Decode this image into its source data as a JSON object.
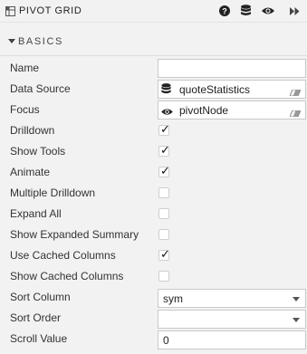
{
  "header": {
    "title": "PIVOT GRID",
    "icons": [
      "pivot-grid-icon",
      "help-icon",
      "database-icon",
      "eye-icon",
      "double-chevron-right-icon"
    ]
  },
  "section": {
    "title": "BASICS",
    "toggle_icon": "caret-down-icon"
  },
  "fields": {
    "name": {
      "label": "Name",
      "value": ""
    },
    "data_source": {
      "label": "Data Source",
      "value": "quoteStatistics",
      "icon": "database-icon"
    },
    "focus": {
      "label": "Focus",
      "value": "pivotNode",
      "icon": "eye-icon"
    },
    "drilldown": {
      "label": "Drilldown",
      "checked": true
    },
    "show_tools": {
      "label": "Show Tools",
      "checked": true
    },
    "animate": {
      "label": "Animate",
      "checked": true
    },
    "multiple_drilldown": {
      "label": "Multiple Drilldown",
      "checked": false
    },
    "expand_all": {
      "label": "Expand All",
      "checked": false
    },
    "show_expanded_summary": {
      "label": "Show Expanded Summary",
      "checked": false
    },
    "use_cached_columns": {
      "label": "Use Cached Columns",
      "checked": true
    },
    "show_cached_columns": {
      "label": "Show Cached Columns",
      "checked": false
    },
    "sort_column": {
      "label": "Sort Column",
      "value": "sym"
    },
    "sort_order": {
      "label": "Sort Order",
      "value": ""
    },
    "scroll_value": {
      "label": "Scroll Value",
      "value": "0"
    }
  },
  "check_glyph": "✓"
}
